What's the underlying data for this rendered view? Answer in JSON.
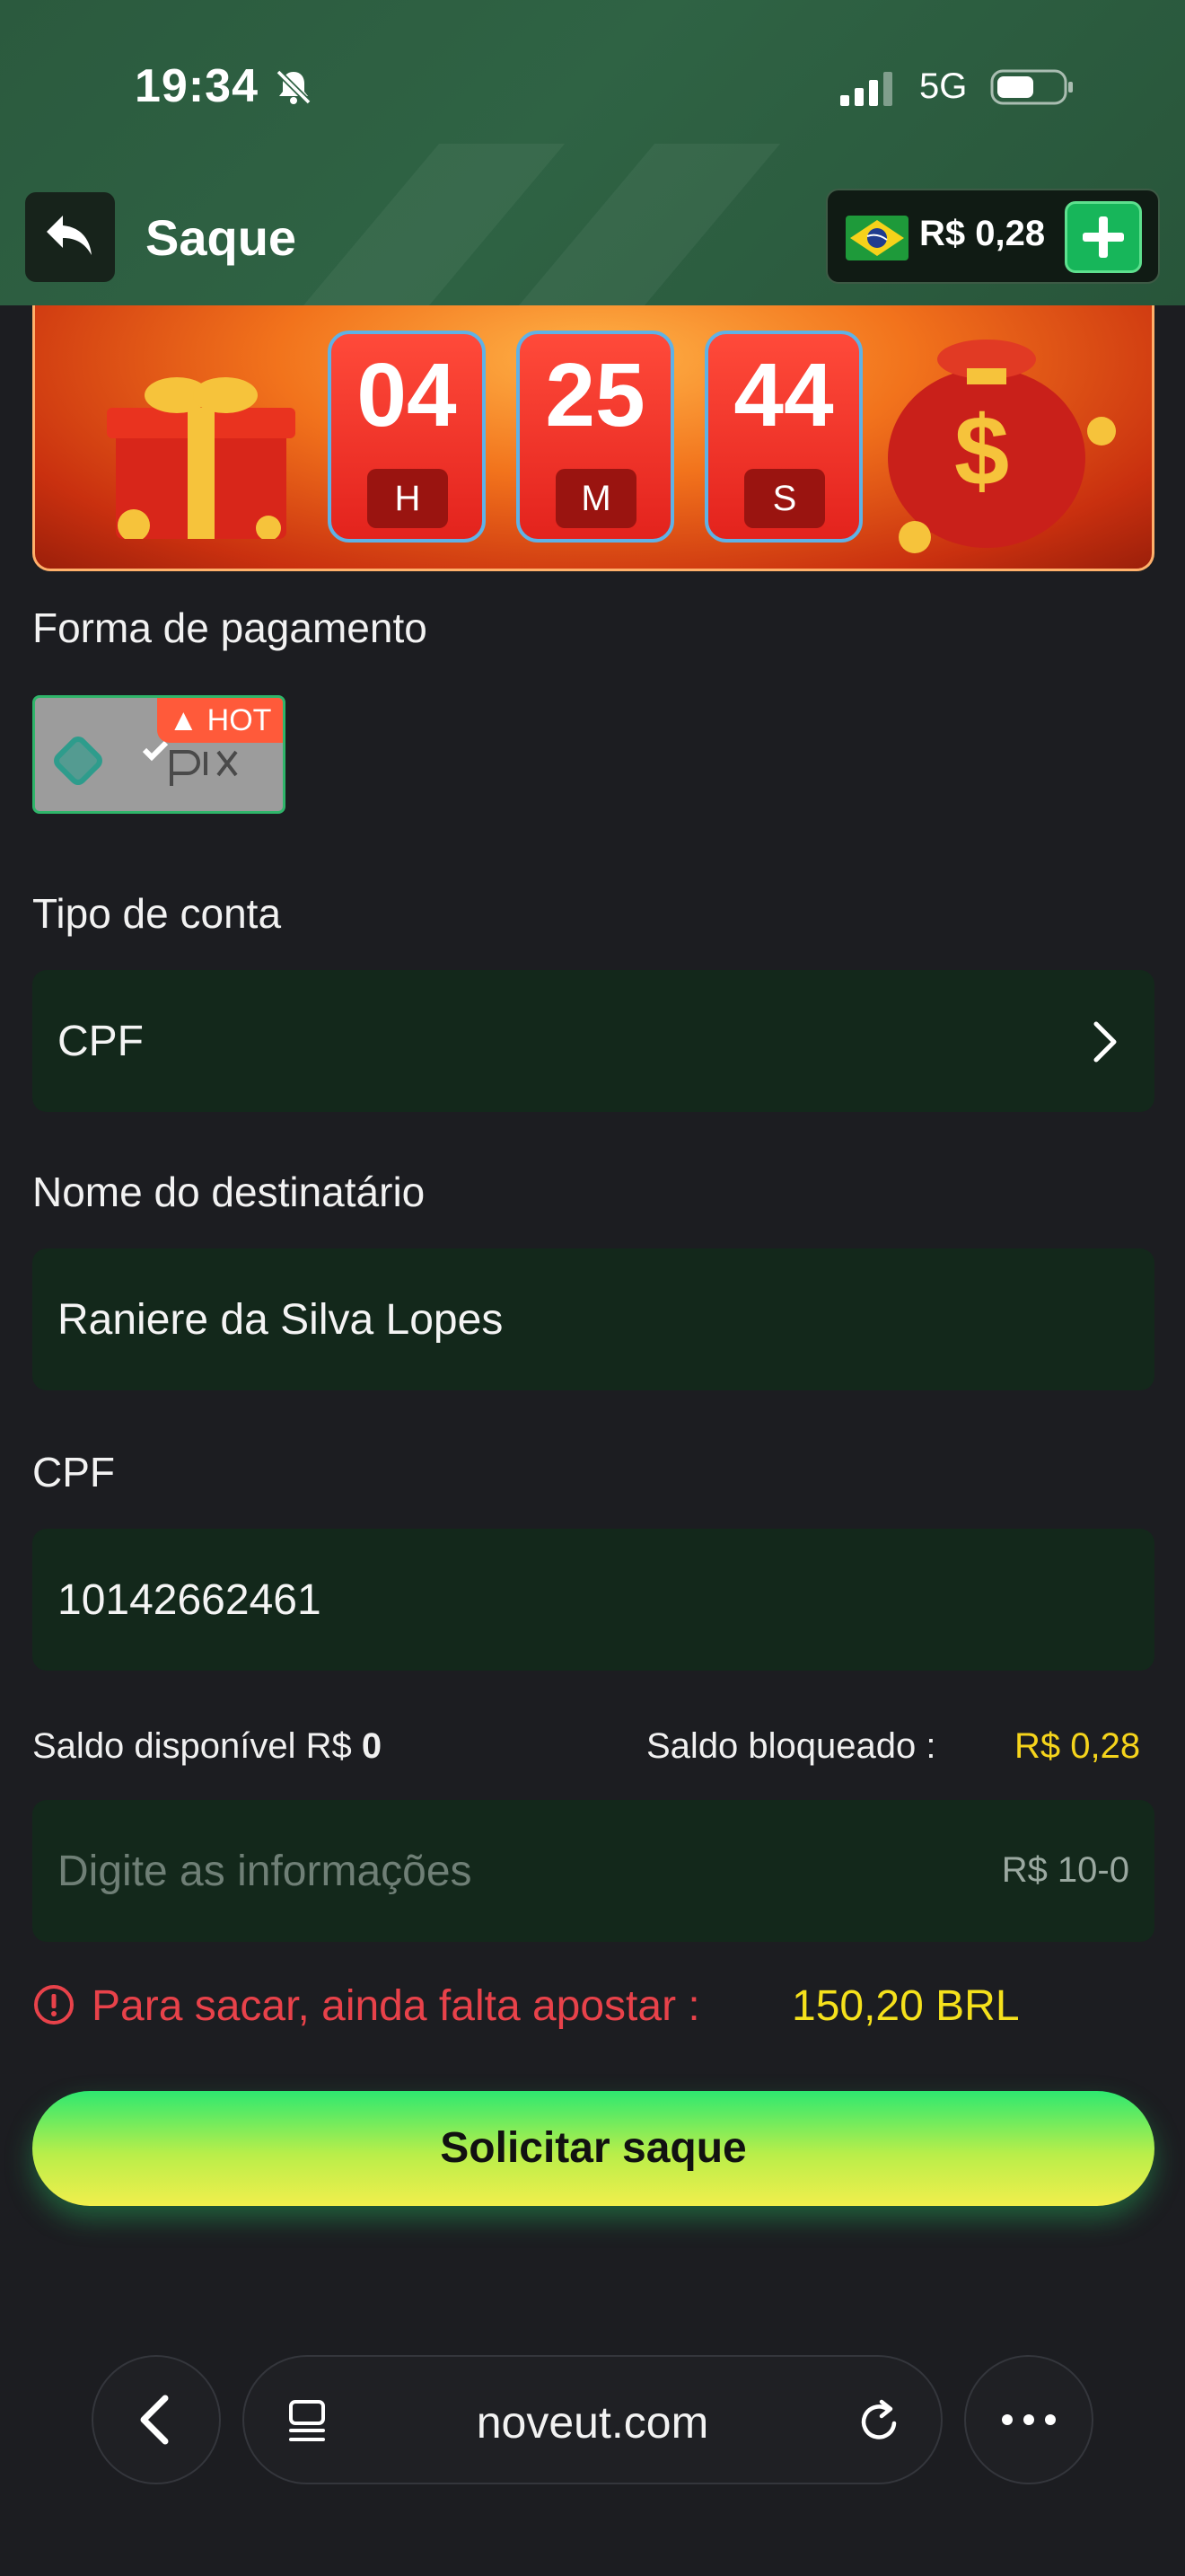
{
  "status_bar": {
    "time": "19:34",
    "network": "5G"
  },
  "header": {
    "title": "Saque",
    "balance": "R$ 0,28"
  },
  "banner": {
    "hours": "04",
    "hours_unit": "H",
    "minutes": "25",
    "minutes_unit": "M",
    "seconds": "44",
    "seconds_unit": "S"
  },
  "payment": {
    "label": "Forma de pagamento",
    "method": "pix",
    "badge": "HOT"
  },
  "account_type": {
    "label": "Tipo de conta",
    "value": "CPF"
  },
  "recipient": {
    "label": "Nome do destinatário",
    "value": "Raniere da Silva Lopes"
  },
  "cpf": {
    "label": "CPF",
    "value": "10142662461"
  },
  "saldo": {
    "available_label": "Saldo disponível R$ ",
    "available_value": "0",
    "blocked_label": "Saldo bloqueado :",
    "blocked_value": "R$ 0,28"
  },
  "amount": {
    "placeholder": "Digite as informações",
    "range": "R$ 10-0"
  },
  "warning": {
    "text": "Para sacar, ainda falta apostar :",
    "value": "150,20 BRL"
  },
  "submit_label": "Solicitar saque",
  "browser": {
    "url": "noveut.com"
  },
  "colors": {
    "accent_green": "#2ee870",
    "warning_red": "#e8424a",
    "highlight_yellow": "#f5d41c"
  }
}
